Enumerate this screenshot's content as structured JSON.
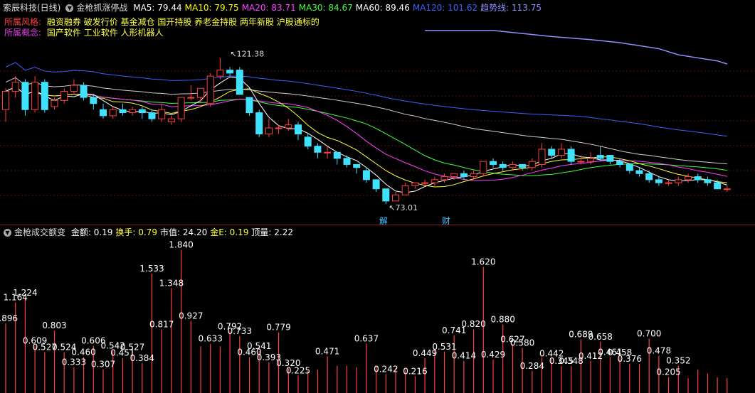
{
  "header": {
    "stock": "索辰科技(日线)",
    "indicator": "金枪抓涨停战",
    "ma": [
      {
        "label": "MA5: 79.44",
        "color": "#ffffff"
      },
      {
        "label": "MA10: 79.75",
        "color": "#ffff00"
      },
      {
        "label": "MA20: 83.71",
        "color": "#ff40ff"
      },
      {
        "label": "MA30: 84.67",
        "color": "#40ff40"
      },
      {
        "label": "MA60: 89.46",
        "color": "#ffffff"
      },
      {
        "label": "MA120: 101.62",
        "color": "#4060ff"
      },
      {
        "label": "趋势线: 113.75",
        "color": "#9090ff"
      }
    ]
  },
  "tags": {
    "style_label": "所属风格:",
    "style_value": "融资融券 破发行价 基金减仓 国开持股 养老金持股 两年新股 沪股通标的",
    "concept_label": "所属概念:",
    "concept_value": "国产软件 工业软件 人形机器人"
  },
  "markers": {
    "m1": "解",
    "m2": "财"
  },
  "volume_header": {
    "indicator": "金枪成交额变",
    "items": [
      {
        "label": "金额: 0.19",
        "color": "#ffffff"
      },
      {
        "label": "换手: 0.79",
        "color": "#ffff40"
      },
      {
        "label": "市值: 24.20",
        "color": "#ffffff"
      },
      {
        "label": "金E: 0.19",
        "color": "#ffff40"
      },
      {
        "label": "顶量: 2.22",
        "color": "#ffffff"
      }
    ]
  },
  "chart_data": {
    "type": "candlestick",
    "price_range": [
      70,
      126
    ],
    "high_label": "121.38",
    "low_label": "73.01",
    "candles": [
      [
        104,
        110,
        111,
        100
      ],
      [
        110,
        113,
        115,
        108
      ],
      [
        113,
        104,
        114,
        102
      ],
      [
        104,
        113,
        115,
        103
      ],
      [
        113,
        104,
        114,
        103
      ],
      [
        105,
        107,
        108,
        104
      ],
      [
        107,
        110,
        111,
        106
      ],
      [
        110,
        112,
        114,
        109
      ],
      [
        112,
        108,
        113,
        107
      ],
      [
        108,
        106,
        109,
        104
      ],
      [
        104,
        102,
        106,
        101
      ],
      [
        102,
        104,
        105,
        101
      ],
      [
        104,
        103,
        106,
        102
      ],
      [
        103,
        104,
        105,
        102
      ],
      [
        104,
        103,
        105,
        101
      ],
      [
        103,
        101,
        104,
        100
      ],
      [
        101,
        104,
        106,
        100
      ],
      [
        100,
        101,
        102,
        99
      ],
      [
        101,
        108,
        108,
        100
      ],
      [
        108,
        108,
        112,
        107
      ],
      [
        108,
        111,
        111,
        106
      ],
      [
        106,
        115,
        116,
        105
      ],
      [
        115,
        117,
        121,
        114
      ],
      [
        117,
        116,
        118,
        115
      ],
      [
        117,
        109,
        118,
        109
      ],
      [
        108,
        103,
        108,
        102
      ],
      [
        103,
        96,
        104,
        95
      ],
      [
        96,
        98,
        101,
        95
      ],
      [
        98,
        98,
        99,
        96
      ],
      [
        98,
        99,
        101,
        97
      ],
      [
        99,
        96,
        100,
        94
      ],
      [
        95,
        92,
        96,
        91
      ],
      [
        92,
        90,
        93,
        88
      ],
      [
        90,
        90,
        92,
        88
      ],
      [
        90,
        88,
        90,
        86
      ],
      [
        88,
        86,
        89,
        85
      ],
      [
        86,
        85,
        86,
        83
      ],
      [
        84,
        81,
        85,
        80
      ],
      [
        81,
        78,
        81,
        77
      ],
      [
        78,
        74,
        78,
        73
      ],
      [
        74,
        76,
        77,
        74
      ],
      [
        76,
        79,
        80,
        76
      ],
      [
        79,
        80,
        80,
        78
      ],
      [
        80,
        80,
        81,
        79
      ],
      [
        80,
        81,
        82,
        79
      ],
      [
        81,
        82,
        83,
        80
      ],
      [
        82,
        83,
        83,
        81
      ],
      [
        83,
        82,
        84,
        81
      ],
      [
        82,
        83,
        84,
        81
      ],
      [
        83,
        87,
        87,
        82
      ],
      [
        87,
        86,
        88,
        85
      ],
      [
        86,
        85,
        87,
        84
      ],
      [
        85,
        86,
        87,
        84
      ],
      [
        86,
        85,
        86,
        84
      ],
      [
        85,
        87,
        88,
        84
      ],
      [
        86,
        91,
        93,
        85
      ],
      [
        91,
        89,
        92,
        88
      ],
      [
        89,
        91,
        93,
        88
      ],
      [
        91,
        87,
        92,
        86
      ],
      [
        87,
        87,
        89,
        86
      ],
      [
        87,
        88,
        90,
        86
      ],
      [
        89,
        88,
        92,
        87
      ],
      [
        89,
        87,
        89,
        86
      ],
      [
        87,
        86,
        88,
        85
      ],
      [
        86,
        84,
        86,
        83
      ],
      [
        84,
        83,
        85,
        82
      ],
      [
        83,
        81,
        84,
        80
      ],
      [
        81,
        80,
        82,
        79
      ],
      [
        80,
        80,
        81,
        79
      ],
      [
        80,
        81,
        82,
        79
      ],
      [
        81,
        82,
        83,
        80
      ],
      [
        82,
        81,
        83,
        80
      ],
      [
        81,
        80,
        82,
        79
      ],
      [
        80,
        78,
        81,
        78
      ],
      [
        78,
        78,
        79,
        77
      ]
    ],
    "volume_range": [
      0,
      1.9
    ],
    "volume": [
      0.896,
      1.164,
      1.224,
      0.609,
      0.527,
      0.803,
      0.524,
      0.333,
      0.46,
      0.606,
      0.307,
      0.542,
      0.451,
      0.527,
      0.384,
      1.533,
      0.817,
      1.348,
      1.84,
      0.927,
      0.6,
      0.633,
      0.6,
      0.792,
      0.733,
      0.46,
      0.541,
      0.393,
      0.779,
      0.32,
      0.225,
      0.286,
      0.3,
      0.471,
      0.35,
      0.352,
      0.33,
      0.637,
      0.345,
      0.242,
      0.32,
      0.303,
      0.216,
      0.449,
      0.56,
      0.531,
      0.741,
      0.414,
      0.82,
      1.62,
      0.429,
      0.88,
      0.627,
      0.58,
      0.284,
      0.456,
      0.442,
      0.345,
      0.348,
      0.689,
      0.412,
      0.658,
      0.461,
      0.458,
      0.376,
      0.376,
      0.7,
      0.478,
      0.205,
      0.352,
      0.19,
      0.3,
      0.25,
      0.2,
      0.19
    ],
    "volume_labels": [
      [
        "0.896",
        0
      ],
      [
        "1.164",
        1
      ],
      [
        "1.224",
        2
      ],
      [
        "0.609",
        3
      ],
      [
        "0.527",
        4
      ],
      [
        "0.803",
        5
      ],
      [
        "0.524",
        6
      ],
      [
        "0.333",
        7
      ],
      [
        "0.460",
        8
      ],
      [
        "0.606",
        9
      ],
      [
        "0.307",
        10
      ],
      [
        "0.542",
        11
      ],
      [
        "0.451",
        12
      ],
      [
        "0.527",
        13
      ],
      [
        "0.384",
        14
      ],
      [
        "1.533",
        15
      ],
      [
        "0.817",
        16
      ],
      [
        "1.348",
        17
      ],
      [
        "1.840",
        18
      ],
      [
        "0.927",
        19
      ],
      [
        "0.633",
        21
      ],
      [
        "0.792",
        23
      ],
      [
        "0.733",
        24
      ],
      [
        "0.460",
        25
      ],
      [
        "0.541",
        26
      ],
      [
        "0.393",
        27
      ],
      [
        "0.779",
        28
      ],
      [
        "0.320",
        29
      ],
      [
        "0.225",
        30
      ],
      [
        "0.471",
        33
      ],
      [
        "0.637",
        37
      ],
      [
        "0.242",
        39
      ],
      [
        "0.216",
        42
      ],
      [
        "0.449",
        43
      ],
      [
        "0.531",
        45
      ],
      [
        "0.741",
        46
      ],
      [
        "0.414",
        47
      ],
      [
        "0.820",
        48
      ],
      [
        "1.620",
        49
      ],
      [
        "0.429",
        50
      ],
      [
        "0.880",
        51
      ],
      [
        "0.627",
        52
      ],
      [
        "0.580",
        53
      ],
      [
        "0.284",
        54
      ],
      [
        "0.442",
        56
      ],
      [
        "0.345",
        57
      ],
      [
        "0.348",
        58
      ],
      [
        "0.689",
        59
      ],
      [
        "0.412",
        60
      ],
      [
        "0.658",
        61
      ],
      [
        "0.461",
        62
      ],
      [
        "0.458",
        63
      ],
      [
        "0.376",
        64
      ],
      [
        "0.700",
        66
      ],
      [
        "0.478",
        67
      ],
      [
        "0.205",
        68
      ],
      [
        "0.352",
        69
      ]
    ],
    "trend_line": [
      [
        43,
        130
      ],
      [
        47,
        130
      ],
      [
        50,
        130
      ],
      [
        53,
        129
      ],
      [
        56,
        128
      ],
      [
        60,
        127
      ],
      [
        63,
        126
      ],
      [
        65,
        125
      ],
      [
        67,
        124
      ],
      [
        69,
        122
      ],
      [
        71,
        121
      ],
      [
        73,
        120
      ],
      [
        74,
        119
      ]
    ]
  }
}
